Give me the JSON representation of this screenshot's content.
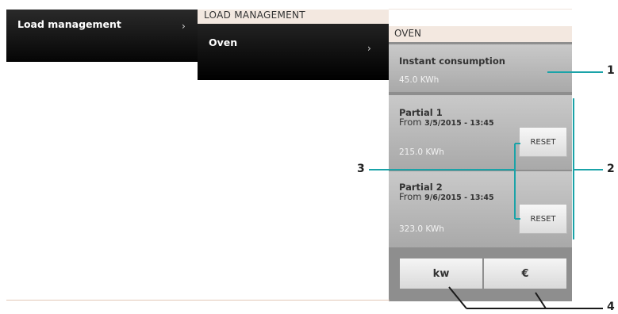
{
  "menu_level1": {
    "item_label": "Load management",
    "chevron": "›"
  },
  "menu_level2": {
    "header": "LOAD MANAGEMENT",
    "item_label": "Oven",
    "chevron": "›"
  },
  "oven": {
    "header": "OVEN",
    "instant": {
      "title": "Instant consumption",
      "value": "45.0 KWh"
    },
    "partial1": {
      "title": "Partial 1",
      "from_label": "From",
      "from_date": "3/5/2015 - 13:45",
      "value": "215.0 KWh",
      "reset_label": "RESET"
    },
    "partial2": {
      "title": "Partial 2",
      "from_label": "From",
      "from_date": "9/6/2015 - 13:45",
      "value": "323.0 KWh",
      "reset_label": "RESET"
    },
    "unit_buttons": {
      "kw_label": "kw",
      "euro_label": "€"
    }
  },
  "callouts": {
    "c1": "1",
    "c2": "2",
    "c3": "3",
    "c4": "4"
  },
  "colors": {
    "callout_line": "#1aa3a8",
    "callout_line_dark": "#1a1a1a"
  }
}
